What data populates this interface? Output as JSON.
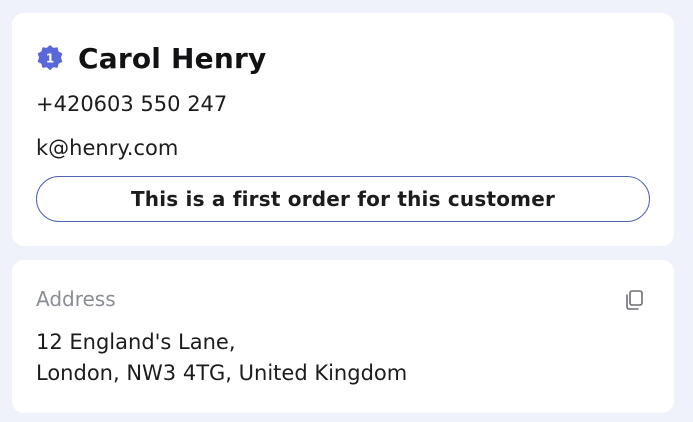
{
  "customer": {
    "order_count": "1",
    "badge_color": "#5a67d8",
    "name": "Carol Henry",
    "phone": "+420603 550 247",
    "email": "k@henry.com",
    "first_order_notice": "This is a first order for this customer",
    "notice_border_color": "#5163b8"
  },
  "address": {
    "label": "Address",
    "line1": "12 England's Lane,",
    "line2": "London, NW3 4TG, United Kingdom",
    "copy_icon": "copy-icon"
  }
}
